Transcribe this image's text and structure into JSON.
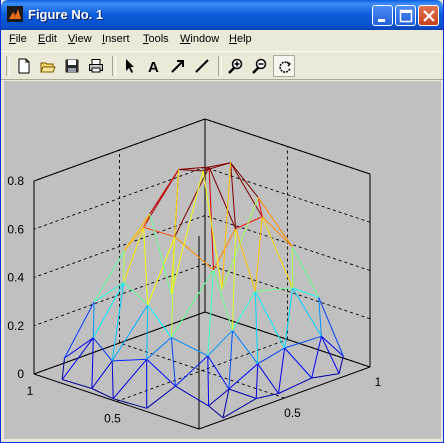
{
  "window": {
    "title": "Figure No. 1"
  },
  "menu": [
    "File",
    "Edit",
    "View",
    "Insert",
    "Tools",
    "Window",
    "Help"
  ],
  "toolbar": {
    "buttons": [
      "new-figure",
      "open-file",
      "save",
      "print",
      "select-arrow",
      "insert-text",
      "insert-arrow",
      "insert-line",
      "zoom-in",
      "zoom-out",
      "rotate-3d"
    ],
    "text_tool_glyph": "A"
  },
  "chart_data": {
    "type": "trimesh",
    "title": "",
    "xlabel": "",
    "ylabel": "",
    "zlabel": "",
    "xlim": [
      0,
      1
    ],
    "ylim": [
      0,
      1
    ],
    "zlim": [
      0,
      0.8
    ],
    "grid": true,
    "colormap": "jet",
    "z_ticks": [
      "0",
      "0.2",
      "0.4",
      "0.6",
      "0.8"
    ],
    "x_ticks": [
      "0.5",
      "1"
    ],
    "y_ticks": [
      "1",
      "0.5"
    ]
  }
}
